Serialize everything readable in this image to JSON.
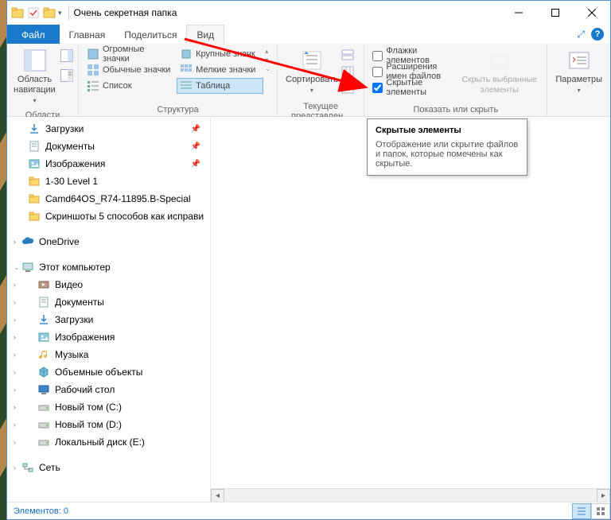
{
  "title": "Очень секретная папка",
  "tabs": {
    "file": "Файл",
    "home": "Главная",
    "share": "Поделиться",
    "view": "Вид"
  },
  "ribbon": {
    "nav_pane": "Область навигации",
    "nav_group": "Области",
    "layout": {
      "huge": "Огромные значки",
      "large": "Крупные значк",
      "normal": "Обычные значки",
      "small": "Мелкие значки",
      "list": "Список",
      "table": "Таблица",
      "group": "Структура"
    },
    "sort": "Сортировать",
    "view_cols_ico1": "",
    "current_view_group": "Текущее представлен...",
    "show_hide": {
      "item_checkboxes": "Флажки элементов",
      "file_ext": "Расширения имен файлов",
      "hidden_items": "Скрытые элементы",
      "group": "Показать или скрыть"
    },
    "hide_selected": "Скрыть выбранные элементы",
    "options": "Параметры"
  },
  "tooltip": {
    "title": "Скрытые элементы",
    "body": "Отображение или скрытие файлов и папок, которые помечены как скрытые."
  },
  "nav": [
    {
      "icon": "download",
      "label": "Загрузки",
      "pin": true
    },
    {
      "icon": "doc",
      "label": "Документы",
      "pin": true
    },
    {
      "icon": "pictures",
      "label": "Изображения",
      "pin": true
    },
    {
      "icon": "folder",
      "label": "1-30 Level 1"
    },
    {
      "icon": "folder",
      "label": "Camd64OS_R74-11895.B-Special"
    },
    {
      "icon": "folder",
      "label": "Скриншоты 5 способов как исправи"
    }
  ],
  "nav_onedrive": "OneDrive",
  "nav_this_pc": "Этот компьютер",
  "nav_pc_items": [
    {
      "icon": "video",
      "label": "Видео"
    },
    {
      "icon": "doc",
      "label": "Документы"
    },
    {
      "icon": "download",
      "label": "Загрузки"
    },
    {
      "icon": "pictures",
      "label": "Изображения"
    },
    {
      "icon": "music",
      "label": "Музыка"
    },
    {
      "icon": "obj3d",
      "label": "Объемные объекты"
    },
    {
      "icon": "desktop",
      "label": "Рабочий стол"
    },
    {
      "icon": "drive",
      "label": "Новый том (C:)"
    },
    {
      "icon": "drive",
      "label": "Новый том (D:)"
    },
    {
      "icon": "drive",
      "label": "Локальный диск (E:)"
    }
  ],
  "nav_network": "Сеть",
  "status": "Элементов: 0"
}
